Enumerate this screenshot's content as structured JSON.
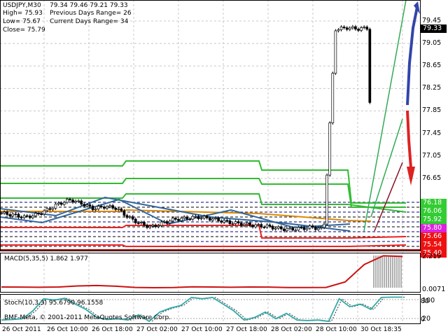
{
  "header": {
    "symbol": "USDJPY,M30",
    "ohlc": "79.34 79.46 79.21 79.33",
    "high": "High= 75.93",
    "low": "Low= 75.67",
    "close": "Close= 75.79",
    "prev_range": "Previous Days Range= 26",
    "curr_range": "Current Days Range= 34"
  },
  "price_axis": [
    "79.45",
    "79.05",
    "78.65",
    "78.25",
    "77.85",
    "77.45",
    "77.05",
    "76.65"
  ],
  "price_axis_values": [
    79.45,
    79.05,
    78.65,
    78.25,
    77.85,
    77.45,
    77.05,
    76.65
  ],
  "current_price": "79.33",
  "level_boxes": [
    {
      "label": "76.18",
      "color": "#33cc33"
    },
    {
      "label": "76.06",
      "color": "#33cc33"
    },
    {
      "label": "75.92",
      "color": "#33cc33"
    },
    {
      "label": "75.80",
      "color": "#dd22dd"
    },
    {
      "label": "75.66",
      "color": "#ee1111"
    },
    {
      "label": "75.54",
      "color": "#ee1111"
    },
    {
      "label": "75.40",
      "color": "#ee1111"
    }
  ],
  "macd": {
    "label": "MACD(5,35,5) 1.862 1.977",
    "axis_top": "2.219",
    "axis_bottom": "0.0071"
  },
  "stoch": {
    "label": "Stoch(10,3,3) 95.6790 96.1558",
    "levels": [
      "100",
      "80",
      "20",
      "0"
    ]
  },
  "watermark": "BMF-Meta, © 2001-2011 MetaQuotes Software Corp.",
  "time_axis": [
    "26 Oct 2011",
    "26 Oct 10:00",
    "26 Oct 18:00",
    "27 Oct 02:00",
    "27 Oct 10:00",
    "27 Oct 18:00",
    "28 Oct 02:00",
    "28 Oct 10:00",
    "30 Oct 18:35"
  ],
  "chart_data": {
    "type": "candlestick",
    "symbol": "USDJPY",
    "timeframe": "M30",
    "close_path": [
      76.03,
      76.0,
      75.96,
      76.0,
      76.09,
      76.2,
      76.27,
      76.2,
      76.11,
      76.15,
      76.12,
      75.96,
      75.85,
      75.78,
      75.86,
      75.92,
      75.94,
      75.96,
      75.94,
      75.9,
      75.86,
      75.84,
      75.81,
      75.8,
      75.76,
      75.74,
      75.76,
      75.78,
      75.74,
      79.3,
      79.33,
      79.31,
      79.33
    ],
    "macd_path": [
      0.05,
      0.04,
      0.03,
      0.05,
      0.12,
      0.15,
      0.1,
      0.02,
      0.0,
      0.01,
      0.06,
      0.05,
      0.03,
      0.05,
      0.04,
      0.01,
      0.01,
      0.02,
      0.4,
      1.6,
      2.2,
      2.15
    ],
    "stoch_path": [
      10,
      12,
      15,
      45,
      90,
      85,
      92,
      70,
      50,
      20,
      12,
      15,
      10,
      30,
      5,
      40,
      55,
      65,
      95,
      90,
      95,
      70,
      45,
      10,
      20,
      40,
      15,
      35,
      10,
      8,
      10,
      5,
      90,
      60,
      70,
      50,
      95,
      96,
      96
    ],
    "ylim": [
      75.4,
      79.6
    ]
  }
}
